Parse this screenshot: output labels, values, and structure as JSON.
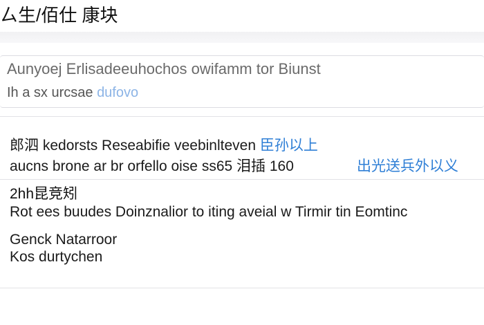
{
  "header": {
    "title": "ㄙ生/佰仕 康块"
  },
  "search": {
    "value": "Aunyoej Erlisadeeuhochos owifamm tor Biunst",
    "hint_prefix": "Ih a sx urcsae ",
    "hint_link": "dufovo"
  },
  "result": {
    "line1_text": "郎泗 kedorsts Reseabifie veebinlteven ",
    "line1_link": "臣孙以上",
    "line2_text": "aucns brone ar br orfello oise ss65 泪插 160",
    "line2_link": "出光送兵外以义"
  },
  "section": {
    "heading": "2hh昆竞矧",
    "description": "Rot ees buudes Doinznalior to iting aveial w Tirmir tin Eomtinc"
  },
  "footer": {
    "line1": "Genck Natarroor",
    "line2": "Kos durtychen"
  }
}
